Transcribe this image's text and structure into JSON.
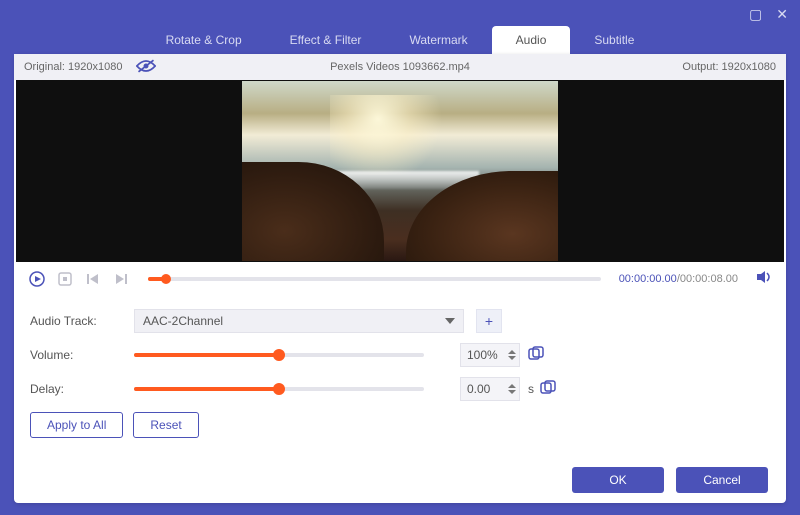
{
  "window": {
    "maximize_glyph": "▢",
    "close_glyph": "✕"
  },
  "tabs": {
    "rotate_crop": "Rotate & Crop",
    "effect_filter": "Effect & Filter",
    "watermark": "Watermark",
    "audio": "Audio",
    "subtitle": "Subtitle"
  },
  "info": {
    "original_label": "Original:  1920x1080",
    "filename": "Pexels Videos 1093662.mp4",
    "output_label": "Output:  1920x1080"
  },
  "transport": {
    "current_time": "00:00:00.00",
    "sep": "/",
    "total_time": "00:00:08.00"
  },
  "form": {
    "audio_track_label": "Audio Track:",
    "audio_track_value": "AAC-2Channel",
    "add_glyph": "+",
    "volume_label": "Volume:",
    "volume_value": "100%",
    "volume_pct": 50,
    "delay_label": "Delay:",
    "delay_value": "0.00",
    "delay_pct": 50,
    "delay_unit": "s"
  },
  "buttons": {
    "apply_all": "Apply to All",
    "reset": "Reset",
    "ok": "OK",
    "cancel": "Cancel"
  }
}
